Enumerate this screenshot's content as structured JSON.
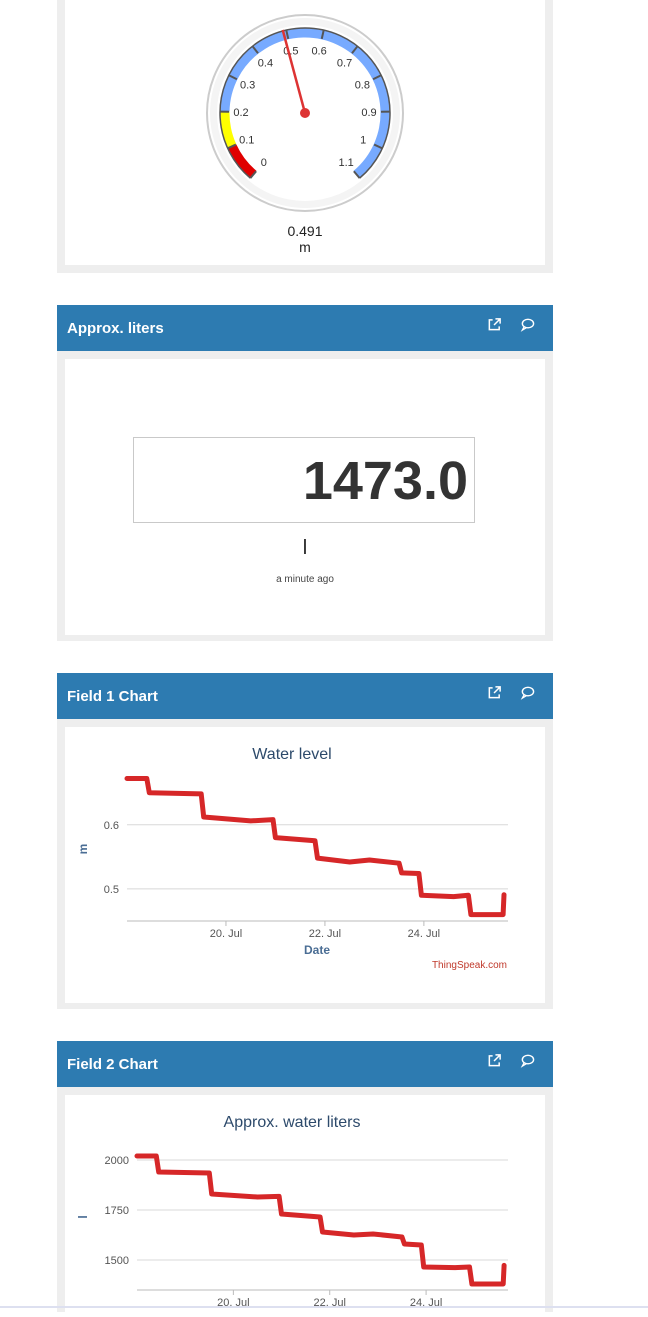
{
  "gauge": {
    "value": 0.491,
    "min": 0,
    "max": 1.1,
    "value_text": "0.491",
    "unit": "m",
    "ticks": [
      "0",
      "0.1",
      "0.2",
      "0.3",
      "0.4",
      "0.5",
      "0.6",
      "0.7",
      "0.8",
      "0.9",
      "1",
      "1.1"
    ],
    "band_colors": {
      "low": "#e00000",
      "mid": "#ffff00",
      "high": "#77aaff"
    }
  },
  "liters_widget": {
    "title": "Approx. liters",
    "value": "1473.0",
    "unit": "l",
    "updated": "a minute ago"
  },
  "field1": {
    "title": "Field 1 Chart",
    "credit": "ThingSpeak.com"
  },
  "field2": {
    "title": "Field 2 Chart"
  },
  "colors": {
    "header": "#2d7bb1",
    "series": "#d62728",
    "title_text": "#2d4a6b"
  },
  "chart_data": [
    {
      "type": "line",
      "title": "Water level",
      "xlabel": "Date",
      "ylabel": "m",
      "xlim": [
        "2024-07-18",
        "2024-07-25.7"
      ],
      "ylim": [
        0.45,
        0.69
      ],
      "yticks": [
        "0.5",
        "0.6"
      ],
      "xticks": [
        "20. Jul",
        "22. Jul",
        "24. Jul"
      ],
      "grid": true,
      "series": [
        {
          "points": [
            [
              "2024-07-18.0",
              0.672
            ],
            [
              "2024-07-18.4",
              0.672
            ],
            [
              "2024-07-18.45",
              0.65
            ],
            [
              "2024-07-19.5",
              0.648
            ],
            [
              "2024-07-19.55",
              0.612
            ],
            [
              "2024-07-20.5",
              0.606
            ],
            [
              "2024-07-20.95",
              0.608
            ],
            [
              "2024-07-21.0",
              0.58
            ],
            [
              "2024-07-21.8",
              0.575
            ],
            [
              "2024-07-21.85",
              0.548
            ],
            [
              "2024-07-22.5",
              0.542
            ],
            [
              "2024-07-22.9",
              0.545
            ],
            [
              "2024-07-23.5",
              0.54
            ],
            [
              "2024-07-23.55",
              0.525
            ],
            [
              "2024-07-23.9",
              0.524
            ],
            [
              "2024-07-23.95",
              0.49
            ],
            [
              "2024-07-24.6",
              0.488
            ],
            [
              "2024-07-24.9",
              0.49
            ],
            [
              "2024-07-24.95",
              0.46
            ],
            [
              "2024-07-25.6",
              0.46
            ],
            [
              "2024-07-25.62",
              0.491
            ]
          ]
        }
      ]
    },
    {
      "type": "line",
      "title": "Approx. water liters",
      "xlabel": "",
      "ylabel": "l",
      "xlim": [
        "2024-07-18",
        "2024-07-25.7"
      ],
      "ylim": [
        1350,
        2100
      ],
      "yticks": [
        "1500",
        "1750",
        "2000"
      ],
      "xticks": [
        "20. Jul",
        "22. Jul",
        "24. Jul"
      ],
      "grid": true,
      "series": [
        {
          "points": [
            [
              "2024-07-18.0",
              2020
            ],
            [
              "2024-07-18.4",
              2020
            ],
            [
              "2024-07-18.45",
              1940
            ],
            [
              "2024-07-19.5",
              1935
            ],
            [
              "2024-07-19.55",
              1830
            ],
            [
              "2024-07-20.5",
              1815
            ],
            [
              "2024-07-20.95",
              1818
            ],
            [
              "2024-07-21.0",
              1730
            ],
            [
              "2024-07-21.8",
              1715
            ],
            [
              "2024-07-21.85",
              1640
            ],
            [
              "2024-07-22.5",
              1625
            ],
            [
              "2024-07-22.9",
              1630
            ],
            [
              "2024-07-23.5",
              1615
            ],
            [
              "2024-07-23.55",
              1580
            ],
            [
              "2024-07-23.9",
              1575
            ],
            [
              "2024-07-23.95",
              1465
            ],
            [
              "2024-07-24.6",
              1462
            ],
            [
              "2024-07-24.9",
              1465
            ],
            [
              "2024-07-24.95",
              1380
            ],
            [
              "2024-07-25.6",
              1380
            ],
            [
              "2024-07-25.62",
              1473
            ]
          ]
        }
      ]
    }
  ]
}
